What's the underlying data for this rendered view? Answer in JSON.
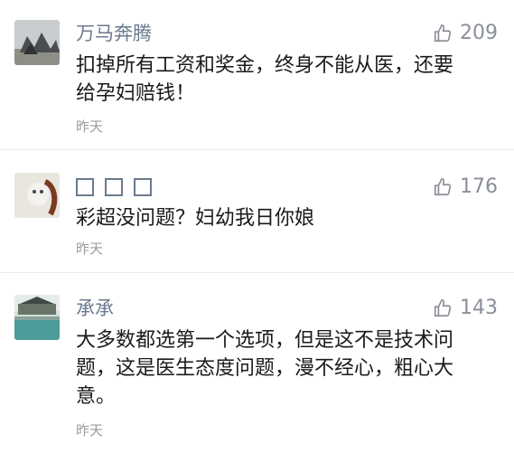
{
  "comments": [
    {
      "username": "万马奔腾",
      "likes": "209",
      "text_lines": [
        "扣掉所有工资和奖金，终身不能从医，还要",
        "给孕妇赔钱！"
      ],
      "time": "昨天"
    },
    {
      "username": "",
      "likes": "176",
      "text_lines": [
        "彩超没问题？妇幼我日你娘"
      ],
      "time": "昨天"
    },
    {
      "username": "承承",
      "likes": "143",
      "text_lines": [
        "大多数都选第一个选项，但是这不是技术问",
        "题，这是医生态度问题，漫不经心，粗心大",
        "意。"
      ],
      "time": "昨天"
    }
  ]
}
